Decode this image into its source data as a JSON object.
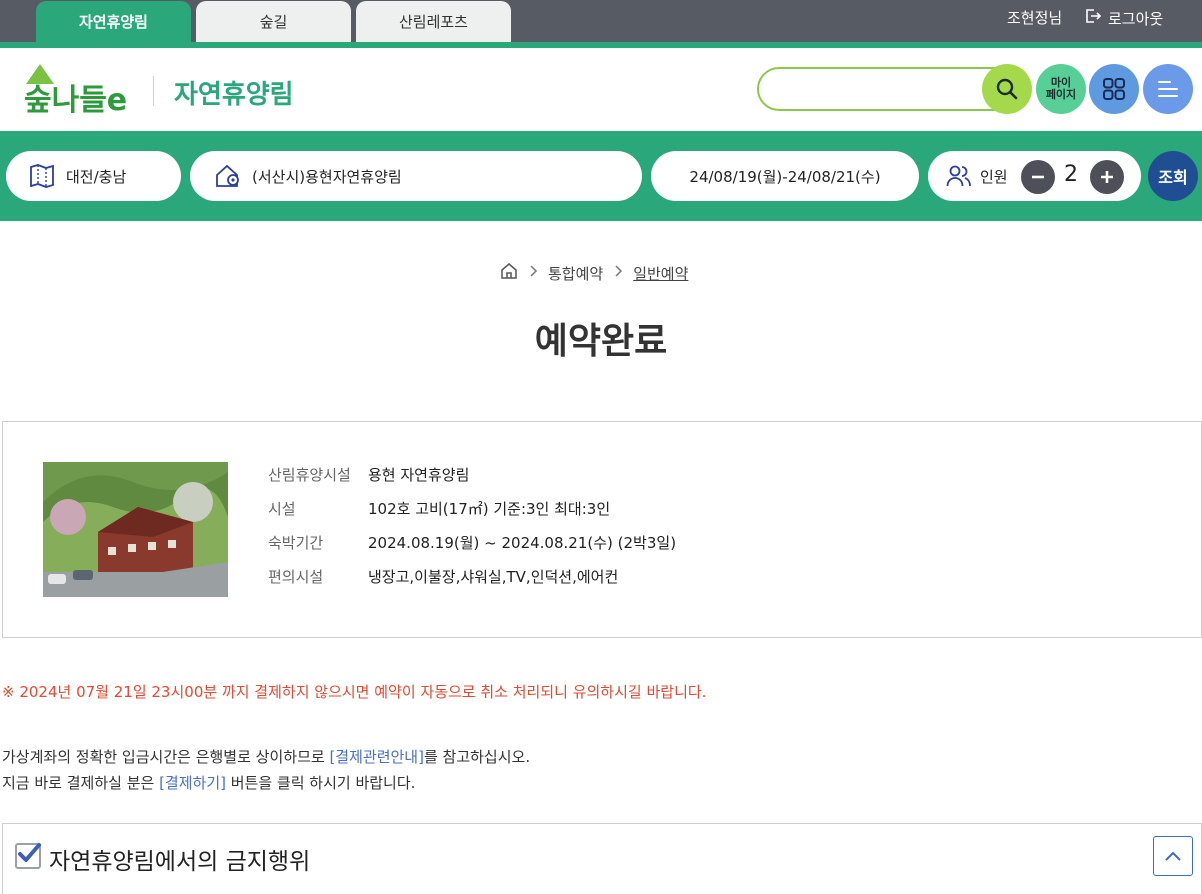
{
  "topbar": {
    "tabs": [
      {
        "label": "자연휴양림",
        "active": true
      },
      {
        "label": "숲길",
        "active": false
      },
      {
        "label": "산림레포츠",
        "active": false
      }
    ],
    "user_name": "조현정님",
    "logout_label": "로그아웃"
  },
  "header": {
    "logo_text": "숲나들e",
    "site_name": "자연휴양림",
    "search_value": "",
    "mypage_line1": "마이",
    "mypage_line2": "페이지"
  },
  "filter": {
    "region": "대전/충남",
    "forest": "(서산시)용현자연휴양림",
    "dates": "24/08/19(월)-24/08/21(수)",
    "people_label": "인원",
    "people_count": "2",
    "search_button": "조회"
  },
  "breadcrumb": {
    "level1": "통합예약",
    "level2": "일반예약"
  },
  "page_title": "예약완료",
  "reservation": {
    "rows": [
      {
        "key": "산림휴양시설",
        "value": "용현 자연휴양림"
      },
      {
        "key": "시설",
        "value": "102호 고비(17㎡) 기준:3인 최대:3인"
      },
      {
        "key": "숙박기간",
        "value": "2024.08.19(월) ~ 2024.08.21(수) (2박3일)"
      },
      {
        "key": "편의시설",
        "value": "냉장고,이불장,샤워실,TV,인덕션,에어컨"
      }
    ]
  },
  "warning": "※ 2024년 07월 21일 23시00분 까지 결제하지 않으시면 예약이 자동으로 취소 처리되니 유의하시길 바랍니다.",
  "notes": {
    "line1_pre": "가상계좌의 정확한 입금시간은 은행별로 상이하므로 ",
    "line1_link": "[결제관련안내]",
    "line1_post": "를 참고하십시오.",
    "line2_pre": "지금 바로 결제하실 분은 ",
    "line2_link": "[결제하기]",
    "line2_post": " 버튼을 클릭 하시기 바랍니다."
  },
  "accordion": {
    "title": "자연휴양림에서의 금지행위"
  },
  "colors": {
    "brand_green": "#2aa77b",
    "topbar_gray": "#575b64",
    "warning_red": "#e24a33",
    "link_blue": "#4a6fc7",
    "navy_button": "#1f4e93"
  }
}
